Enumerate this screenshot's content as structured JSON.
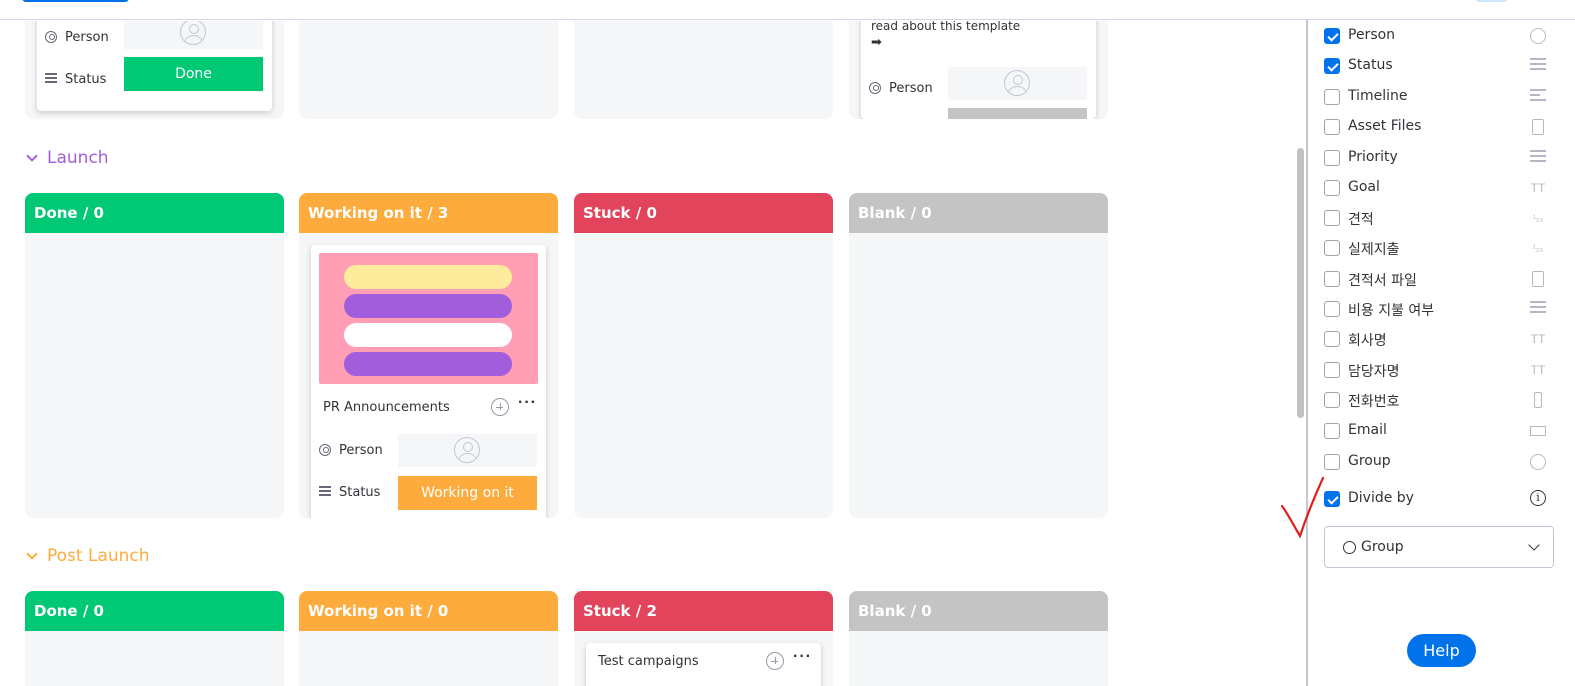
{
  "groups": {
    "launch": {
      "title": "Launch",
      "color": "#a25ddc"
    },
    "post_launch": {
      "title": "Post Launch",
      "color": "#fdab3d"
    }
  },
  "top_group": {
    "card1": {
      "person_label": "Person",
      "status_label": "Status",
      "status_value": "Done"
    },
    "card4": {
      "text": "read about this template",
      "arrow": "➡",
      "person_label": "Person"
    }
  },
  "launch_columns": {
    "done": "Done / 0",
    "working": "Working on it / 3",
    "stuck": "Stuck / 0",
    "blank": "Blank / 0"
  },
  "launch_card": {
    "title": "PR Announcements",
    "more": "···",
    "person_label": "Person",
    "status_label": "Status",
    "status_value": "Working on it",
    "image_colors": [
      "#ffeb9c",
      "#a25ddc",
      "#ffffff",
      "#a25ddc"
    ]
  },
  "post_launch_columns": {
    "done": "Done / 0",
    "working": "Working on it / 0",
    "stuck": "Stuck / 2",
    "blank": "Blank / 0"
  },
  "post_launch_card": {
    "title": "Test campaigns",
    "more": "···"
  },
  "panel": {
    "columns": [
      {
        "label": "Person",
        "checked": true,
        "icon": "person-icon"
      },
      {
        "label": "Status",
        "checked": true,
        "icon": "status-icon"
      },
      {
        "label": "Timeline",
        "checked": false,
        "icon": "timeline-icon"
      },
      {
        "label": "Asset Files",
        "checked": false,
        "icon": "file-icon"
      },
      {
        "label": "Priority",
        "checked": false,
        "icon": "status-icon"
      },
      {
        "label": "Goal",
        "checked": false,
        "icon": "text-icon"
      },
      {
        "label": "견적",
        "checked": false,
        "icon": "numbers-icon"
      },
      {
        "label": "실제지출",
        "checked": false,
        "icon": "numbers-icon"
      },
      {
        "label": "견적서 파일",
        "checked": false,
        "icon": "file-icon"
      },
      {
        "label": "비용 지불 여부",
        "checked": false,
        "icon": "status-icon"
      },
      {
        "label": "회사명",
        "checked": false,
        "icon": "text-icon"
      },
      {
        "label": "담당자명",
        "checked": false,
        "icon": "text-icon"
      },
      {
        "label": "전화번호",
        "checked": false,
        "icon": "phone-icon"
      },
      {
        "label": "Email",
        "checked": false,
        "icon": "email-icon"
      },
      {
        "label": "Group",
        "checked": false,
        "icon": "group-icon"
      }
    ],
    "divide_by": {
      "label": "Divide by",
      "checked": true
    },
    "divide_select": {
      "value": "Group"
    },
    "text_icon_glyph": "TT",
    "numbers_icon_glyph": "¹₂₃",
    "info_glyph": "i"
  },
  "help_button": "Help",
  "colors": {
    "done": "#00c875",
    "working": "#fdab3d",
    "stuck": "#e2445c",
    "blank": "#c4c4c4",
    "accent": "#0073ea"
  }
}
